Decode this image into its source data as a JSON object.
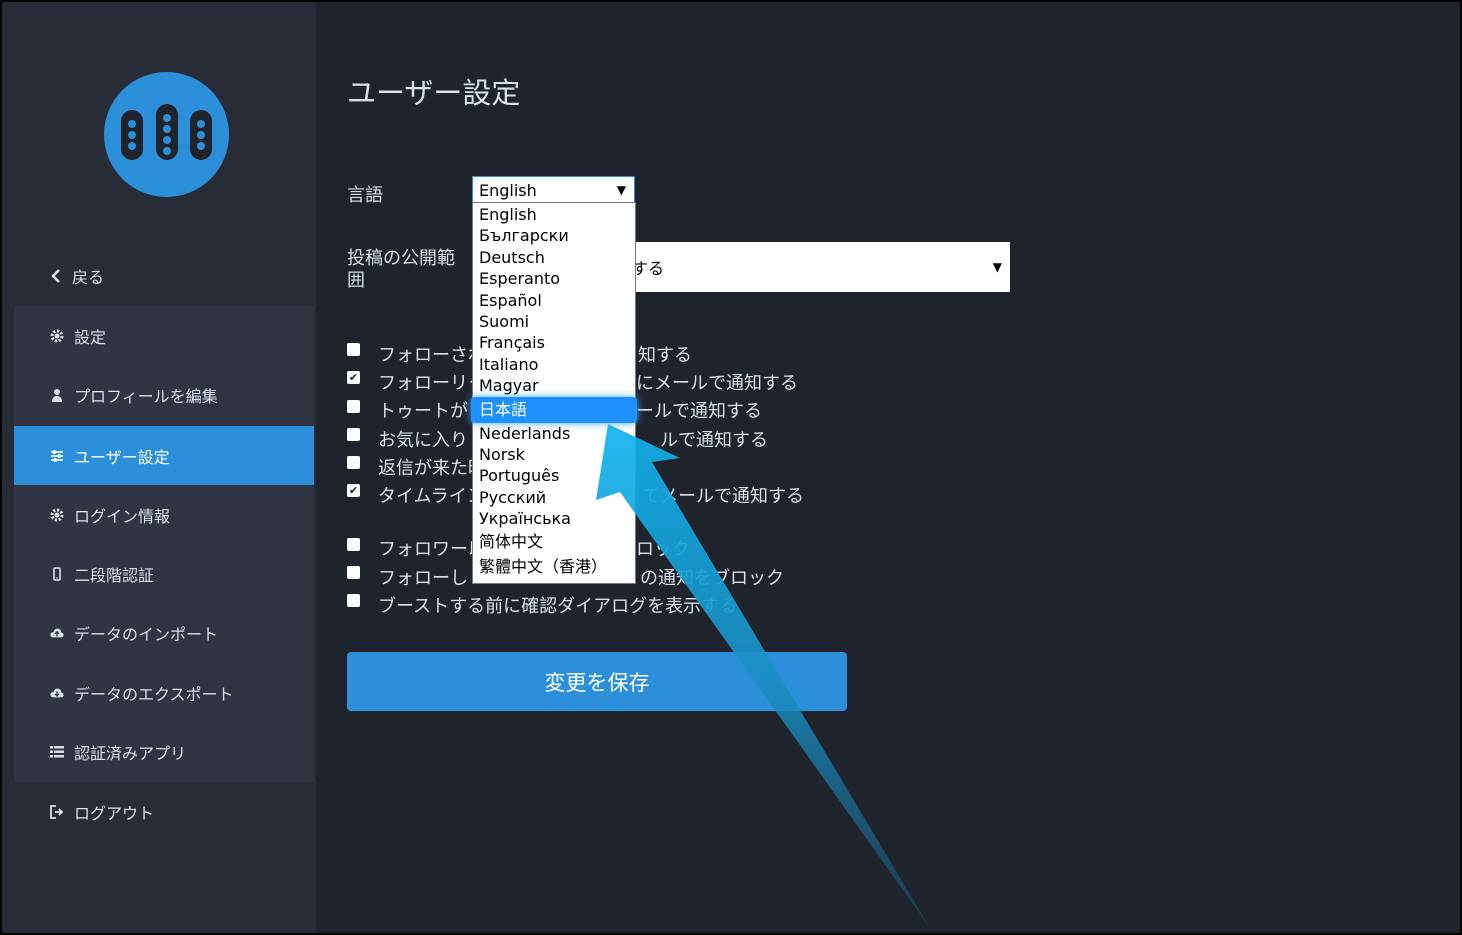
{
  "sidebar": {
    "back_label": "戻る",
    "items": [
      {
        "label": "設定",
        "icon": "gear-icon"
      },
      {
        "label": "プロフィールを編集",
        "icon": "user-icon"
      },
      {
        "label": "ユーザー設定",
        "icon": "sliders-icon",
        "active": true
      },
      {
        "label": "ログイン情報",
        "icon": "gear-icon"
      },
      {
        "label": "二段階認証",
        "icon": "mobile-icon"
      },
      {
        "label": "データのインポート",
        "icon": "cloud-upload-icon"
      },
      {
        "label": "データのエクスポート",
        "icon": "cloud-download-icon"
      },
      {
        "label": "認証済みアプリ",
        "icon": "list-icon"
      }
    ],
    "logout_label": "ログアウト"
  },
  "main": {
    "title": "ユーザー設定",
    "language_label": "言語",
    "language_value": "English",
    "privacy_label_line1": "投稿の公開範",
    "privacy_label_line2": "囲",
    "privacy_value_visible": "する",
    "checkboxes": [
      {
        "label_left": "フォローされ",
        "label_right": "知する",
        "checked": false
      },
      {
        "label_left": "フォローリク",
        "label_right": "にメールで通知する",
        "checked": true
      },
      {
        "label_left": "トゥートが",
        "label_right": "ールで通知する",
        "checked": false
      },
      {
        "label_left": "お気に入り",
        "label_right": "ルで通知する",
        "checked": false
      },
      {
        "label_left": "返信が来た時",
        "label_right": "",
        "checked": false
      },
      {
        "label_left": "タイムライン",
        "label_right": "てメールで通知する",
        "checked": true
      },
      {
        "label_left": "フォロワー以",
        "label_right": "ロック",
        "checked": false
      },
      {
        "label_left": "フォローし",
        "label_right": "の通知をブロック",
        "checked": false
      },
      {
        "label_left": "ブーストする前に確認ダイアログを表示する",
        "label_right": "",
        "checked": false
      }
    ],
    "save_label": "変更を保存"
  },
  "language_dropdown": {
    "options": [
      "English",
      "Български",
      "Deutsch",
      "Esperanto",
      "Español",
      "Suomi",
      "Français",
      "Italiano",
      "Magyar",
      "日本語",
      "Nederlands",
      "Norsk",
      "Português",
      "Русский",
      "Українська",
      "简体中文",
      "繁體中文（香港）"
    ],
    "highlighted": "日本語"
  },
  "colors": {
    "accent": "#2b90d9",
    "sidebar_bg": "#282c37",
    "main_bg": "#1f232b",
    "text": "#d9e1e8",
    "annotation_arrow": "#1ba3dc"
  }
}
